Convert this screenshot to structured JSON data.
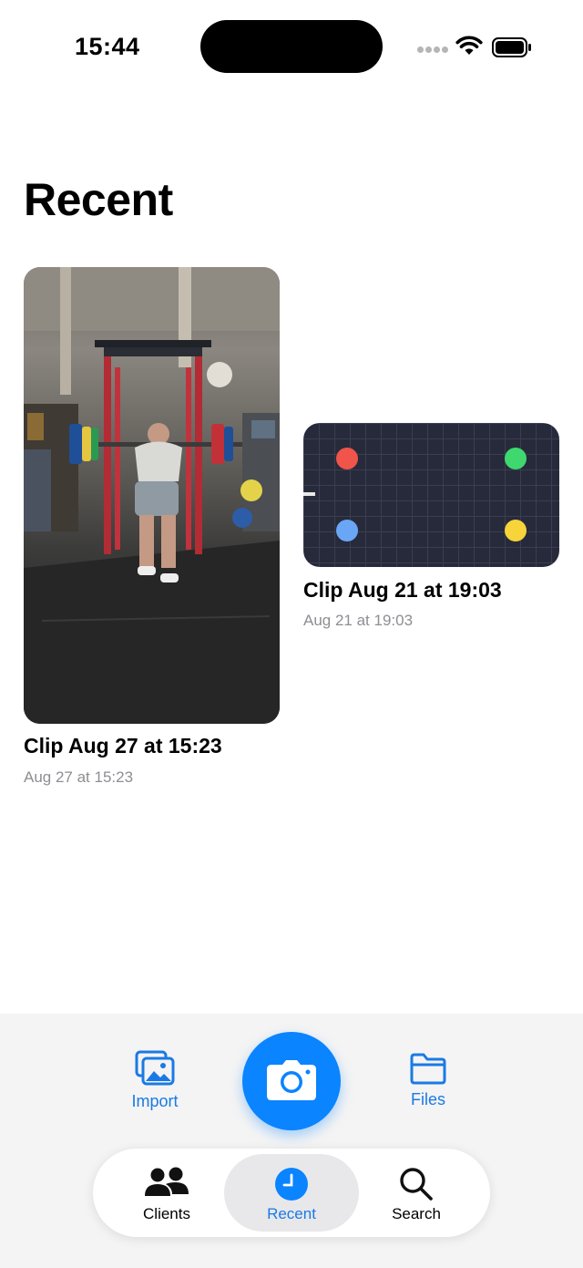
{
  "status_bar": {
    "time": "15:44"
  },
  "page": {
    "title": "Recent"
  },
  "clips": [
    {
      "title": "Clip Aug 27 at 15:23",
      "date": "Aug 27 at 15:23",
      "thumbnail": "gym-video-frame"
    },
    {
      "title": "Clip Aug 21 at 19:03",
      "date": "Aug 21 at 19:03",
      "thumbnail": "dot-grid",
      "dot_colors": [
        "#f0544a",
        "#3ed86e",
        "#6aa6f6",
        "#f6d43a"
      ]
    }
  ],
  "actions": {
    "import_label": "Import",
    "files_label": "Files",
    "camera": "camera-icon"
  },
  "tabs": [
    {
      "label": "Clients",
      "icon": "people-icon",
      "active": false
    },
    {
      "label": "Recent",
      "icon": "clock-icon",
      "active": true
    },
    {
      "label": "Search",
      "icon": "search-icon",
      "active": false
    }
  ],
  "colors": {
    "accent": "#0a84ff",
    "accent_text": "#1a7ae5",
    "secondary_text": "#8e8e93"
  }
}
